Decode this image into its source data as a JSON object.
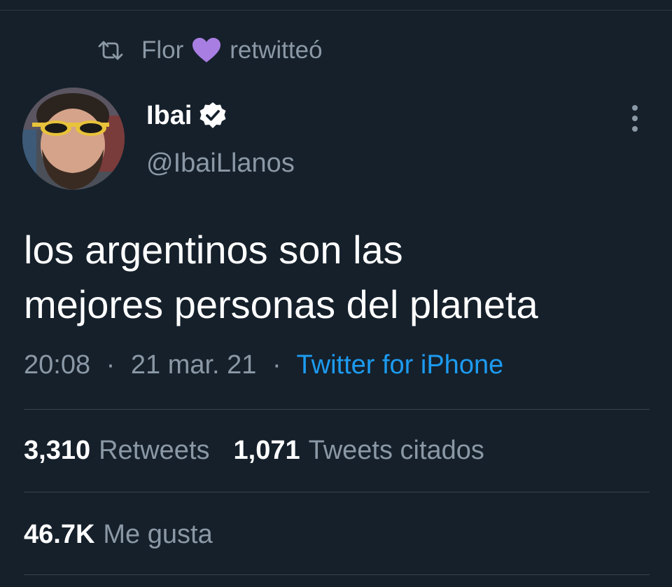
{
  "retweet_context": {
    "retweeter_name": "Flor",
    "action_label": "retwitteó",
    "icons": [
      "retweet-icon",
      "purple-heart-icon"
    ],
    "heart_color": "#a97ee2"
  },
  "author": {
    "display_name": "Ibai",
    "handle": "@IbaiLlanos",
    "verified": true
  },
  "tweet": {
    "text_line_1": "los argentinos son las",
    "text_line_2": "mejores personas del planeta",
    "time": "20:08",
    "date": "21 mar. 21",
    "separator": "·",
    "source": "Twitter for iPhone"
  },
  "stats": {
    "retweets_count": "3,310",
    "retweets_label": "Retweets",
    "quotes_count": "1,071",
    "quotes_label": "Tweets citados",
    "likes_count": "46.7K",
    "likes_label": "Me gusta"
  },
  "colors": {
    "background": "#15202b",
    "text_primary": "#ffffff",
    "text_secondary": "#8b98a5",
    "link": "#1d9bf0",
    "divider": "#38444d"
  }
}
